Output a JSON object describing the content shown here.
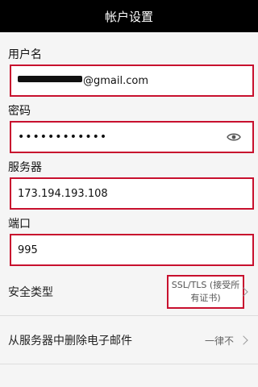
{
  "header": {
    "title": "帐户设置"
  },
  "fields": {
    "username": {
      "label": "用户名",
      "value_suffix": "@gmail.com"
    },
    "password": {
      "label": "密码",
      "value": "••••••••••••"
    },
    "server": {
      "label": "服务器",
      "value": "173.194.193.108"
    },
    "port": {
      "label": "端口",
      "value": "995"
    }
  },
  "settings": {
    "security_type": {
      "label": "安全类型",
      "value_line1": "SSL/TLS (接受所",
      "value_line2": "有证书)"
    },
    "delete_from_server": {
      "label": "从服务器中删除电子邮件",
      "value": "一律不"
    }
  },
  "colors": {
    "highlight": "#c8102e",
    "titlebar": "#000000"
  },
  "icons": {
    "password_toggle": "eye-icon",
    "security_chevron": "chevron-right-icon",
    "delete_chevron": "chevron-right-icon"
  }
}
